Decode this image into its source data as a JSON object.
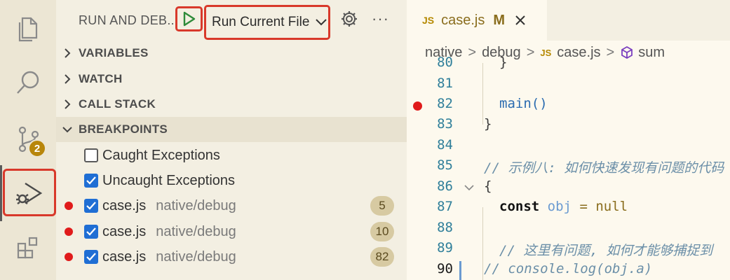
{
  "activity_bar": {
    "scm_badge": "2"
  },
  "debug_panel": {
    "title": "RUN AND DEB...",
    "config": "Run Current File",
    "sections": [
      {
        "label": "VARIABLES",
        "expanded": false
      },
      {
        "label": "WATCH",
        "expanded": false
      },
      {
        "label": "CALL STACK",
        "expanded": false
      },
      {
        "label": "BREAKPOINTS",
        "expanded": true
      }
    ],
    "exceptions": [
      {
        "label": "Caught Exceptions",
        "checked": false
      },
      {
        "label": "Uncaught Exceptions",
        "checked": true
      }
    ],
    "breakpoints": [
      {
        "file": "case.js",
        "path": "native/debug",
        "line": "5"
      },
      {
        "file": "case.js",
        "path": "native/debug",
        "line": "10"
      },
      {
        "file": "case.js",
        "path": "native/debug",
        "line": "82"
      }
    ]
  },
  "editor": {
    "tab": {
      "icon": "JS",
      "name": "case.js",
      "modified": "M"
    },
    "breadcrumbs": [
      "native",
      "debug",
      "case.js",
      "sum"
    ],
    "lines": [
      {
        "num": "80",
        "text": "}"
      },
      {
        "num": "81",
        "text": ""
      },
      {
        "num": "82",
        "text": "main()"
      },
      {
        "num": "83",
        "text": "}"
      },
      {
        "num": "84",
        "text": ""
      },
      {
        "num": "85",
        "text": "// 示例八: 如何快速发现有问题的代码"
      },
      {
        "num": "86",
        "text": "{"
      },
      {
        "num": "87",
        "text_kw": "const",
        "text_var": "obj",
        "text_op": "=",
        "text_null": "null"
      },
      {
        "num": "88",
        "text": ""
      },
      {
        "num": "89",
        "text": "// 这里有问题, 如何才能够捕捉到"
      },
      {
        "num": "90",
        "text": "//   console.log(obj.a)"
      }
    ]
  }
}
